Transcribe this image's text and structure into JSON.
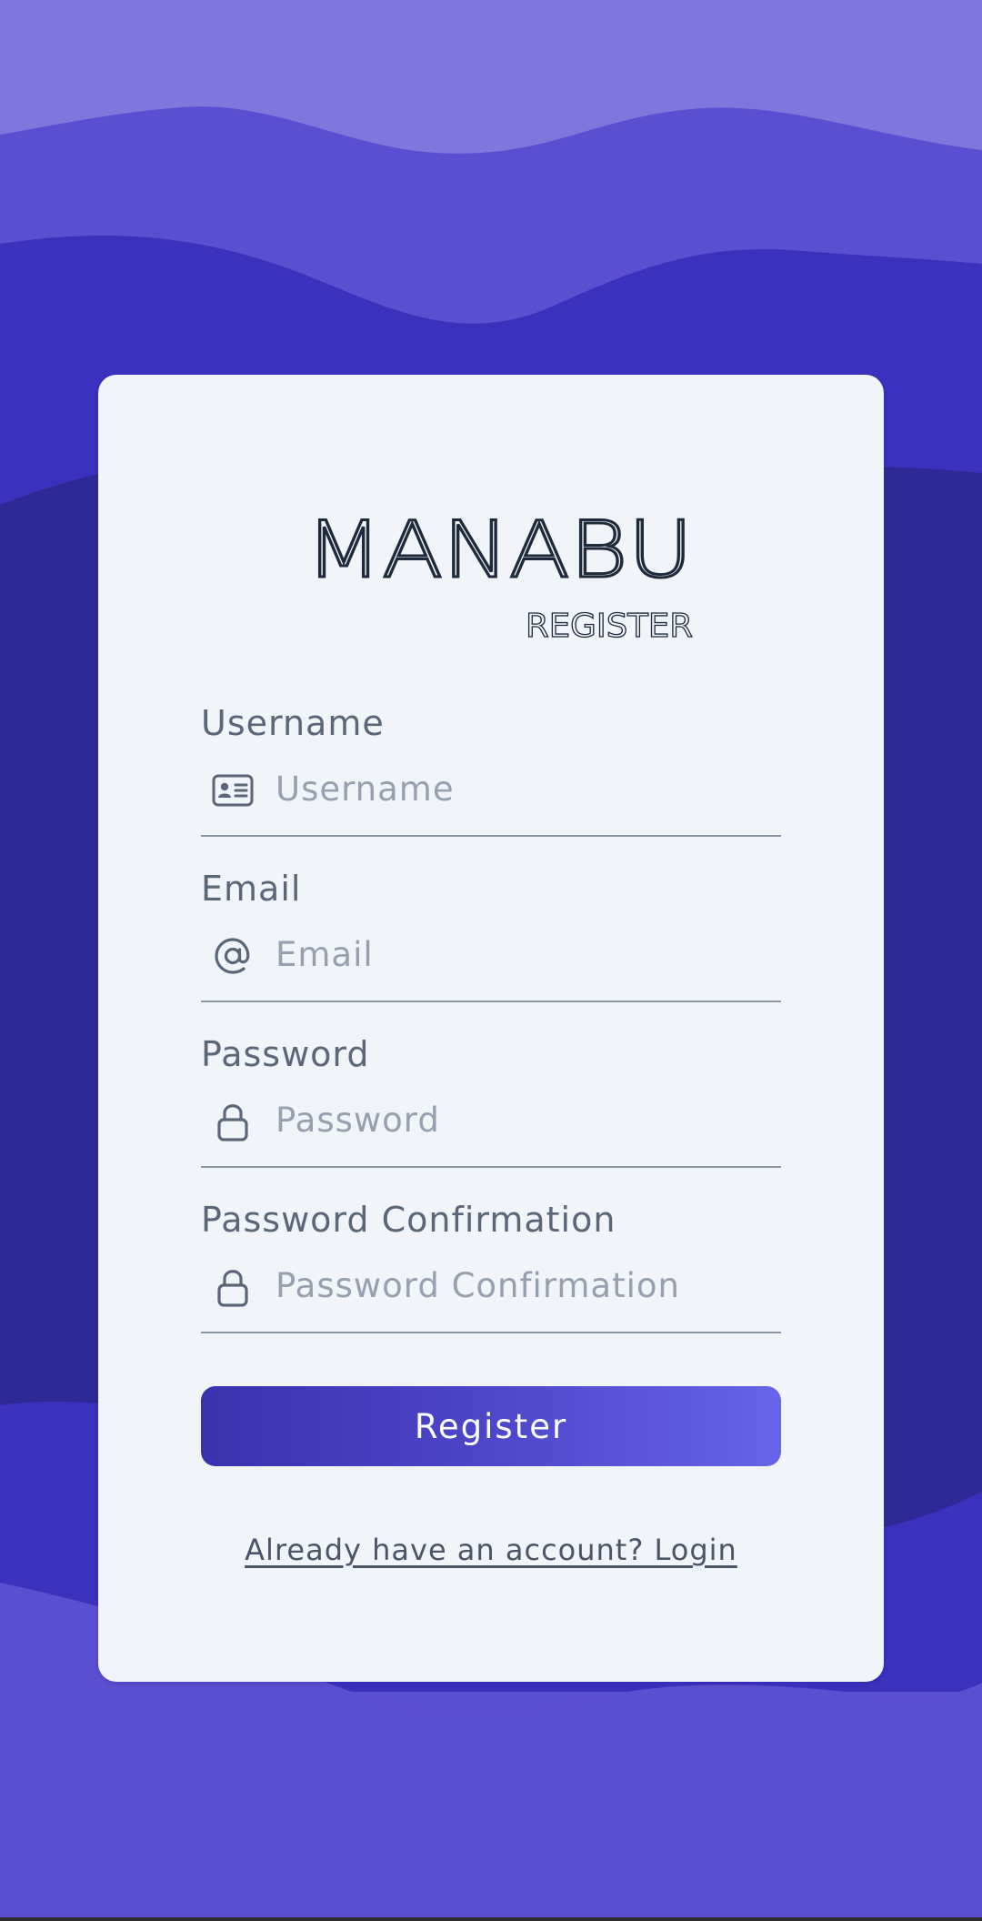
{
  "brand": {
    "name": "MANABU",
    "subtitle": "REGISTER"
  },
  "form": {
    "fields": [
      {
        "label": "Username",
        "placeholder": "Username",
        "icon": "id-card-icon"
      },
      {
        "label": "Email",
        "placeholder": "Email",
        "icon": "at-sign-icon"
      },
      {
        "label": "Password",
        "placeholder": "Password",
        "icon": "lock-icon"
      },
      {
        "label": "Password Confirmation",
        "placeholder": "Password Confirmation",
        "icon": "lock-icon"
      }
    ],
    "submit_label": "Register",
    "login_link": "Already have an account? Login"
  },
  "colors": {
    "button_gradient_start": "#3a31ad",
    "button_gradient_end": "#6664ea",
    "card_background": "#f1f4f9",
    "logo": "#1e293b",
    "label_text": "#5b6678"
  }
}
